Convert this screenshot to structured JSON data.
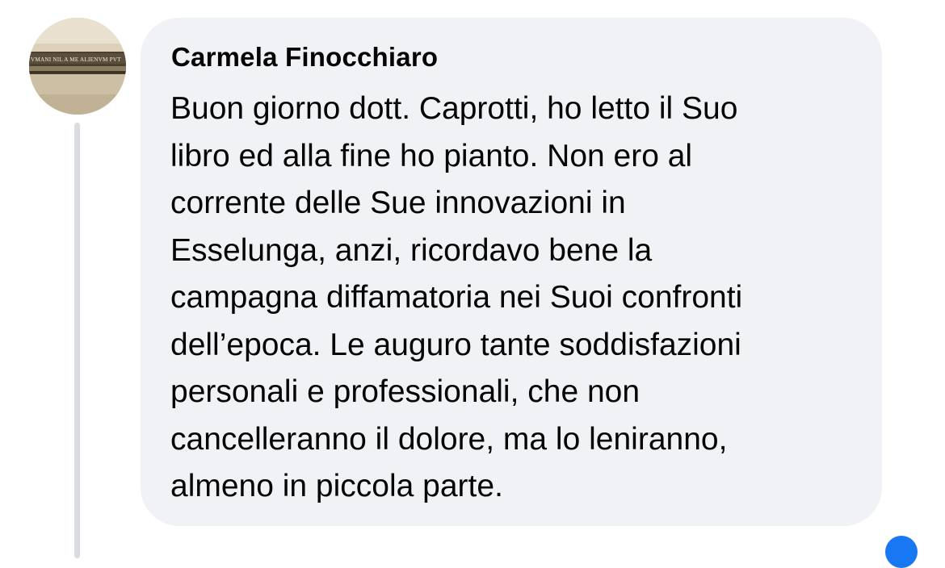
{
  "comment": {
    "author": "Carmela Finocchiaro",
    "lines": [
      "Buon giorno dott. Caprotti, ho letto il Suo",
      "libro ed alla fine ho pianto. Non ero al",
      "corrente delle Sue innovazioni in",
      "Esselunga, anzi, ricordavo bene la",
      "campagna diffamatoria nei Suoi confronti",
      "dell’epoca. Le auguro tante soddisfazioni",
      "personali e professionali, che non",
      "cancelleranno il dolore, ma lo leniranno,",
      "almeno in piccola parte."
    ]
  },
  "avatar": {
    "image_text": "VMANI NIL A ME ALIENVM PVT"
  },
  "colors": {
    "bubble": "#f0f2f5",
    "text": "#050505",
    "thread_line": "#d9dce1",
    "accent": "#1877f2"
  }
}
